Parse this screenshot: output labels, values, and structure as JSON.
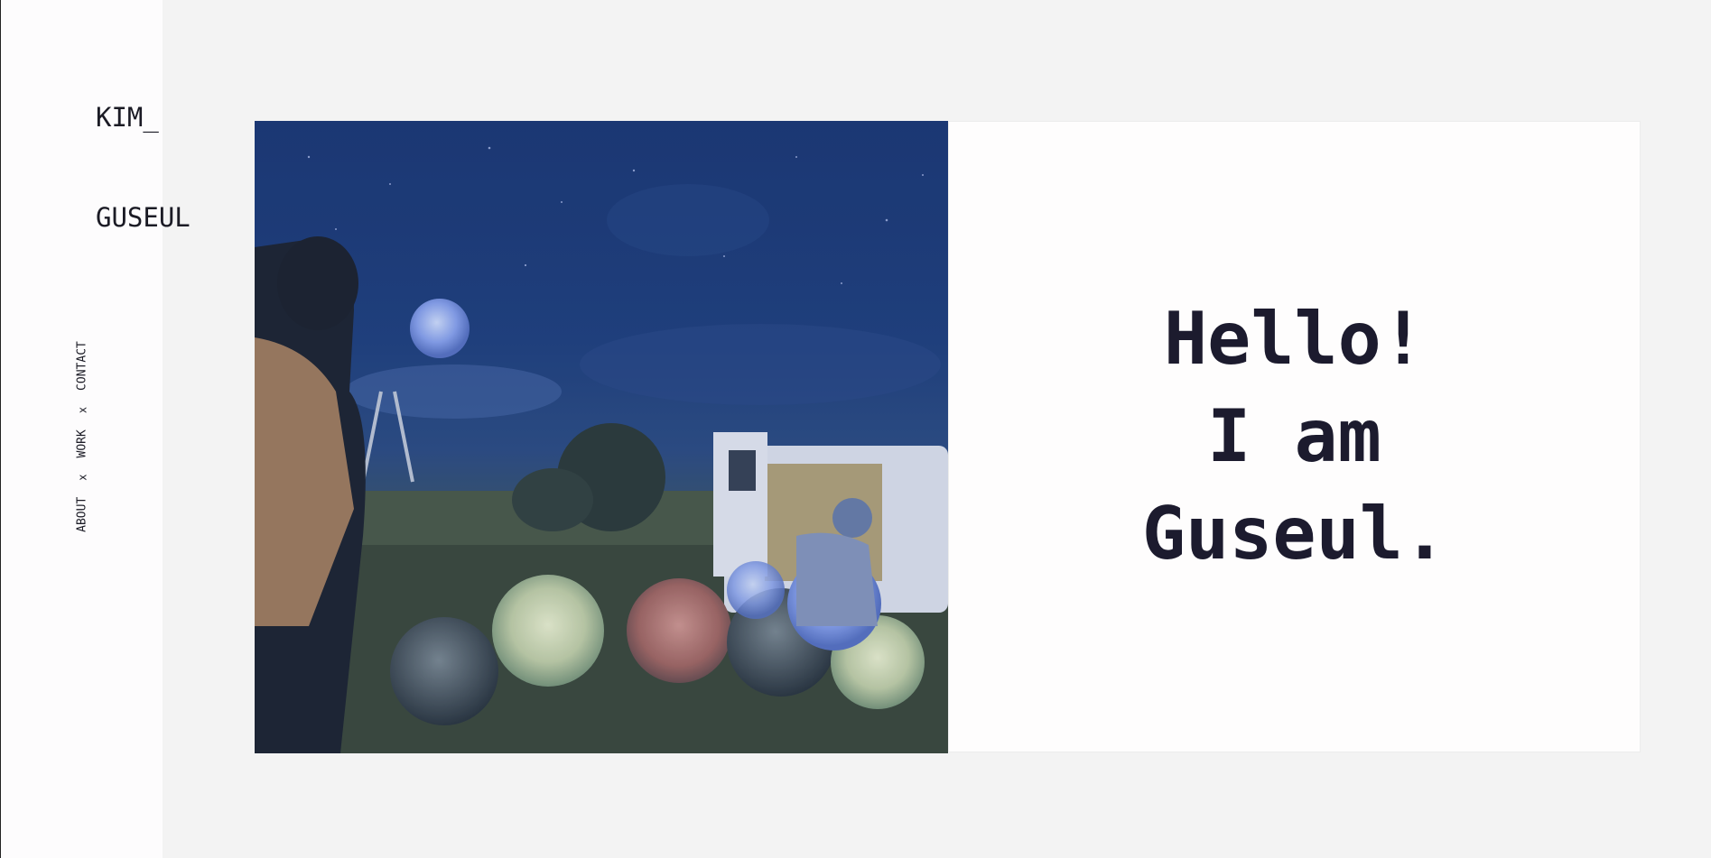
{
  "brand": {
    "line1": "KIM_",
    "line2": "GUSEUL"
  },
  "nav": {
    "items": [
      {
        "label": "ABOUT"
      },
      {
        "label": "WORK"
      },
      {
        "label": "CONTACT"
      }
    ],
    "separator": "x"
  },
  "hero": {
    "image_icon": "photo-moons-in-field",
    "headline": {
      "line1": "Hello!",
      "line2": "I am",
      "line3": "Guseul."
    }
  },
  "colors": {
    "page_bg": "#f3f3f3",
    "sidebar_bg": "#fdfcfd",
    "text": "#1c1b2e",
    "sky": "#1f3f7a"
  }
}
